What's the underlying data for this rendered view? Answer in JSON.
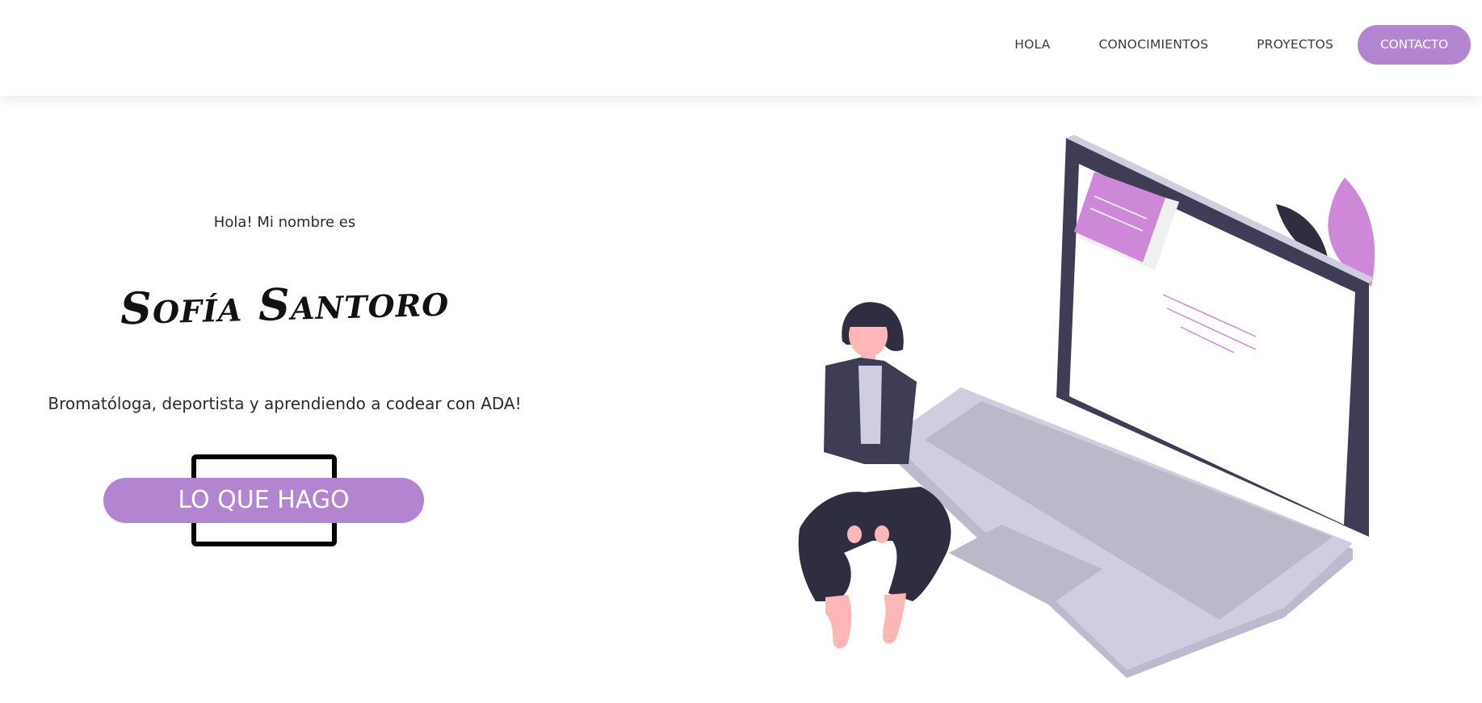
{
  "nav": {
    "items": [
      {
        "label": "HOLA"
      },
      {
        "label": "CONOCIMIENTOS"
      },
      {
        "label": "PROYECTOS"
      },
      {
        "label": "CONTACTO"
      }
    ]
  },
  "hero": {
    "greeting": "Hola! Mi nombre es",
    "name": "Sofía Santoro",
    "tagline": "Bromatóloga, deportista y aprendiendo a codear con ADA!",
    "cta_label": "LO QUE HAGO"
  },
  "colors": {
    "accent": "#b384cf",
    "illustration_purple": "#ce88d8",
    "laptop_dark": "#3f3d56",
    "laptop_light": "#d0cde1",
    "skin": "#ffb6b6"
  },
  "icons": {
    "illustration": "woman-sitting-on-laptop-illustration"
  }
}
